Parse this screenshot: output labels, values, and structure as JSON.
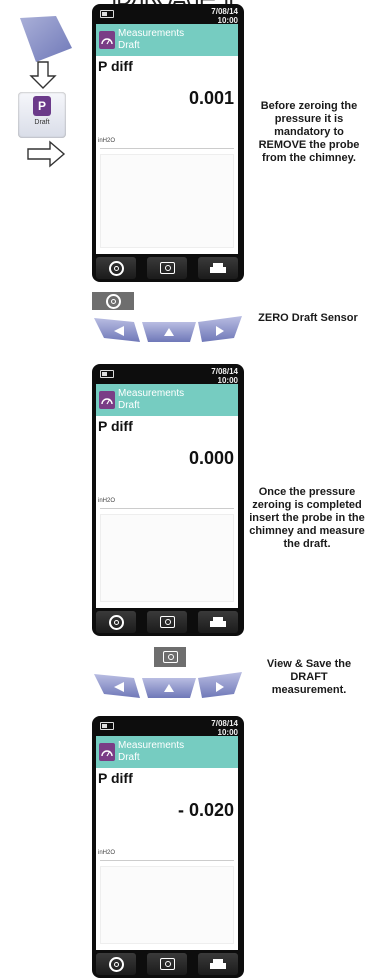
{
  "header": {
    "title_fragment": "DRAFT"
  },
  "left_nav": {
    "draft_tile_label": "Draft",
    "icons": [
      "nav-tile-icon",
      "arrow-down-icon",
      "draft-icon",
      "arrow-right-icon"
    ]
  },
  "screens": [
    {
      "date": "7/08/14",
      "time": "10:00",
      "menu_title": "Measurements",
      "menu_sub": "Draft",
      "param": "P diff",
      "value": "0.001",
      "unit": "inH2O"
    },
    {
      "date": "7/08/14",
      "time": "10:00",
      "menu_title": "Measurements",
      "menu_sub": "Draft",
      "param": "P diff",
      "value": "0.000",
      "unit": "inH2O"
    },
    {
      "date": "7/08/14",
      "time": "10:00",
      "menu_title": "Measurements",
      "menu_sub": "Draft",
      "param": "P diff",
      "value": "- 0.020",
      "unit": "inH2O"
    }
  ],
  "captions": {
    "step1": "Before zeroing the pressure it is mandatory to REMOVE the probe from the chimney.",
    "step2": "ZERO Draft Sensor",
    "step3": "Once the pressure zeroing is completed insert the probe in the chimney and measure the draft.",
    "step4": "View & Save the DRAFT measurement."
  },
  "colors": {
    "header_teal": "#76ccc1",
    "icon_purple": "#7a3d86",
    "keypad_blue": "#6f78b8",
    "screen_black": "#0d0d0d"
  }
}
